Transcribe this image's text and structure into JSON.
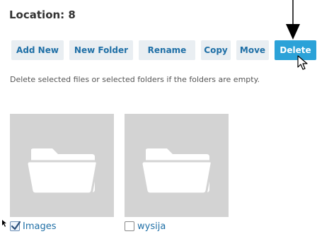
{
  "location": {
    "label": "Location: 8"
  },
  "toolbar": {
    "buttons": [
      {
        "label": "Add New"
      },
      {
        "label": "New Folder"
      },
      {
        "label": "Rename"
      },
      {
        "label": "Copy"
      },
      {
        "label": "Move"
      },
      {
        "label": "Delete"
      }
    ]
  },
  "description": "Delete selected files or selected folders if the folders are empty.",
  "folders": [
    {
      "name": "Images",
      "checked": true,
      "icon": "folder-icon"
    },
    {
      "name": "wysija",
      "checked": false,
      "icon": "folder-icon"
    }
  ],
  "colors": {
    "primary": "#2ba2d8",
    "button_bg": "#e9eef2",
    "button_text": "#1f6fa6",
    "tile_bg": "#d3d3d3"
  }
}
